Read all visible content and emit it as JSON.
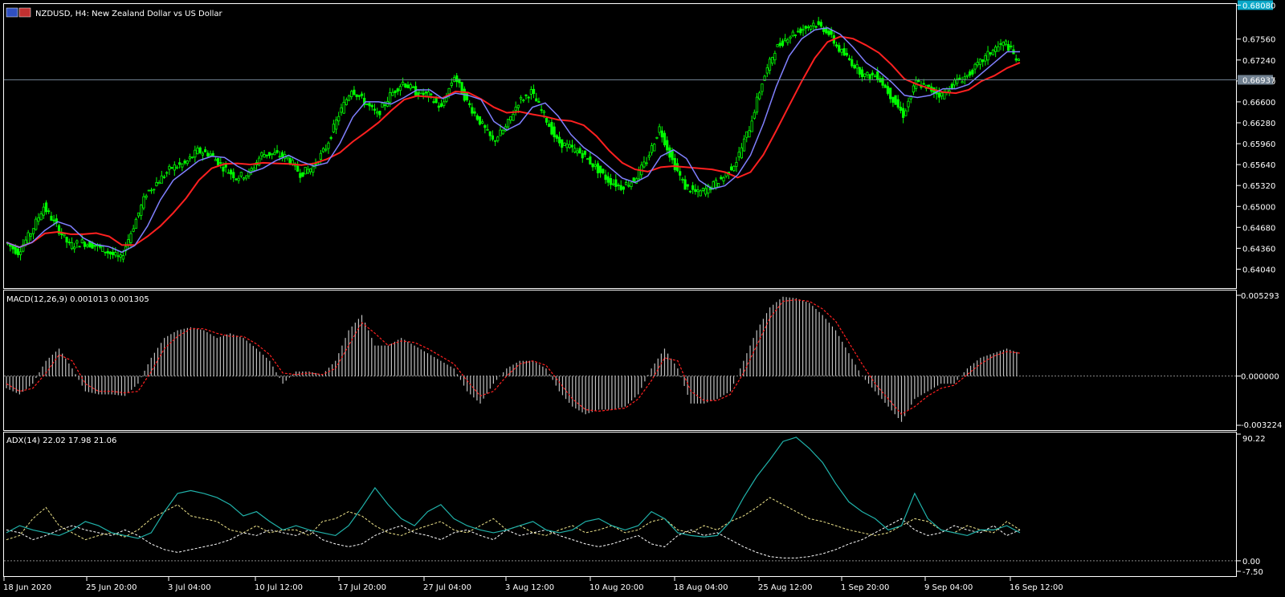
{
  "window": {
    "symbol_title": "NZDUSD, H4:  New Zealand Dollar vs US Dollar",
    "icon": "flag-icon"
  },
  "colors": {
    "background": "#000000",
    "grid": "#ffffff",
    "bull_candle": "#00ff00",
    "fast_ma": "#8080ff",
    "slow_ma": "#ff2020",
    "macd_hist": "#c0c0c0",
    "macd_signal": "#ff2020",
    "adx_main": "#20b2aa",
    "adx_plus": "#f0e68c",
    "adx_minus": "#ffffff",
    "bid_line": "#708090"
  },
  "chart_data": [
    {
      "type": "line",
      "title": "NZDUSD, H4:  New Zealand Dollar vs US Dollar",
      "ylim": [
        0.638,
        0.6806
      ],
      "price_ticks": [
        "0.68080",
        "0.67560",
        "0.67240",
        "0.66920",
        "0.66600",
        "0.66280",
        "0.65960",
        "0.65640",
        "0.65320",
        "0.65000",
        "0.64680",
        "0.64360",
        "0.64040"
      ],
      "current_price": "0.66937",
      "top_price": "0.68080",
      "x_ticks": [
        "18 Jun 2020",
        "25 Jun 20:00",
        "3 Jul 04:00",
        "10 Jul 12:00",
        "17 Jul 20:00",
        "27 Jul 04:00",
        "3 Aug 12:00",
        "10 Aug 20:00",
        "18 Aug 04:00",
        "25 Aug 12:00",
        "1 Sep 20:00",
        "9 Sep 04:00",
        "16 Sep 12:00"
      ],
      "series": [
        {
          "values_close": [
            0.6445,
            0.643,
            0.646,
            0.65,
            0.647,
            0.644,
            0.6445,
            0.644,
            0.643,
            0.642,
            0.647,
            0.652,
            0.654,
            0.656,
            0.6565,
            0.6585,
            0.658,
            0.656,
            0.6545,
            0.655,
            0.658,
            0.658,
            0.6575,
            0.655,
            0.656,
            0.659,
            0.664,
            0.668,
            0.666,
            0.664,
            0.667,
            0.669,
            0.6675,
            0.667,
            0.665,
            0.67,
            0.666,
            0.663,
            0.66,
            0.662,
            0.666,
            0.6675,
            0.664,
            0.66,
            0.659,
            0.658,
            0.656,
            0.654,
            0.653,
            0.654,
            0.657,
            0.662,
            0.657,
            0.653,
            0.652,
            0.653,
            0.6545,
            0.657,
            0.662,
            0.669,
            0.674,
            0.676,
            0.677,
            0.678,
            0.677,
            0.674,
            0.672,
            0.67,
            0.67,
            0.667,
            0.664,
            0.669,
            0.668,
            0.667,
            0.669,
            0.67,
            0.672,
            0.674,
            0.675,
            0.672
          ]
        }
      ]
    },
    {
      "type": "bar",
      "title": "MACD(12,26,9) 0.001013 0.001305",
      "ylim": [
        -0.003224,
        0.005293
      ],
      "ticks": [
        "0.005293",
        "0.000000",
        "-0.003224"
      ],
      "series": [
        {
          "name": "MACD",
          "values": [
            -0.0008,
            -0.0012,
            -0.0005,
            0.001,
            0.0018,
            0.0005,
            -0.001,
            -0.0012,
            -0.0012,
            -0.0013,
            -0.0005,
            0.0012,
            0.0025,
            0.003,
            0.0032,
            0.003,
            0.0025,
            0.0028,
            0.0025,
            0.0018,
            0.001,
            -0.0005,
            0.0003,
            0.0003,
            0.0001,
            0.001,
            0.003,
            0.004,
            0.002,
            0.002,
            0.0025,
            0.002,
            0.0015,
            0.001,
            0.0005,
            -0.001,
            -0.0018,
            -0.0005,
            0.0005,
            0.001,
            0.001,
            0.0005,
            -0.001,
            -0.002,
            -0.0025,
            -0.0022,
            -0.0022,
            -0.002,
            -0.0012,
            0.0005,
            0.0018,
            0.0005,
            -0.0018,
            -0.0018,
            -0.0015,
            -0.001,
            0.001,
            0.003,
            0.0045,
            0.0052,
            0.0051,
            0.0048,
            0.004,
            0.003,
            0.0015,
            0.0,
            -0.001,
            -0.002,
            -0.003,
            -0.0015,
            -0.001,
            -0.0005,
            -0.0005,
            0.0005,
            0.0012,
            0.0015,
            0.0018,
            0.0015
          ]
        },
        {
          "name": "Signal",
          "values": [
            -0.0005,
            -0.001,
            -0.0008,
            0.0002,
            0.0014,
            0.001,
            -0.0005,
            -0.001,
            -0.001,
            -0.0011,
            -0.001,
            0.0003,
            0.0018,
            0.0026,
            0.0031,
            0.0031,
            0.0028,
            0.0026,
            0.0026,
            0.0021,
            0.0014,
            0.0002,
            0.0001,
            0.0002,
            0.0001,
            0.0005,
            0.002,
            0.0035,
            0.0028,
            0.002,
            0.0023,
            0.0022,
            0.0018,
            0.0013,
            0.0008,
            -0.0003,
            -0.0013,
            -0.001,
            0.0,
            0.0008,
            0.001,
            0.0007,
            -0.0004,
            -0.0015,
            -0.0022,
            -0.0023,
            -0.0022,
            -0.0021,
            -0.0015,
            -0.0003,
            0.0012,
            0.001,
            -0.001,
            -0.0016,
            -0.0016,
            -0.0012,
            0.0002,
            0.002,
            0.0038,
            0.0049,
            0.005,
            0.0049,
            0.0044,
            0.0036,
            0.0022,
            0.0008,
            -0.0005,
            -0.0015,
            -0.0025,
            -0.002,
            -0.0013,
            -0.0008,
            -0.0006,
            0.0001,
            0.0008,
            0.0013,
            0.0016,
            0.0015
          ]
        }
      ]
    },
    {
      "type": "line",
      "title": "ADX(14) 22.02 17.98 21.06",
      "ylim": [
        -7.5,
        90.22
      ],
      "ticks": [
        "90.22",
        "0.00",
        "-7.50"
      ],
      "series": [
        {
          "name": "ADX",
          "values": [
            20,
            25,
            22,
            20,
            18,
            22,
            28,
            25,
            20,
            18,
            16,
            20,
            35,
            48,
            50,
            48,
            45,
            40,
            32,
            35,
            28,
            22,
            25,
            22,
            20,
            18,
            25,
            38,
            52,
            40,
            30,
            25,
            35,
            40,
            30,
            25,
            22,
            20,
            22,
            25,
            28,
            22,
            20,
            22,
            28,
            30,
            25,
            22,
            25,
            35,
            30,
            20,
            18,
            17,
            18,
            28,
            45,
            60,
            72,
            85,
            88,
            80,
            70,
            55,
            42,
            35,
            30,
            22,
            25,
            48,
            30,
            22,
            20,
            18,
            22,
            22,
            25,
            20
          ]
        },
        {
          "name": "+DI",
          "values": [
            15,
            18,
            30,
            38,
            25,
            20,
            15,
            18,
            20,
            17,
            22,
            30,
            35,
            40,
            32,
            30,
            28,
            22,
            20,
            25,
            20,
            22,
            22,
            18,
            28,
            30,
            35,
            32,
            25,
            20,
            18,
            22,
            25,
            28,
            22,
            20,
            25,
            30,
            22,
            25,
            20,
            18,
            22,
            25,
            20,
            22,
            25,
            20,
            22,
            28,
            30,
            22,
            20,
            25,
            22,
            28,
            32,
            38,
            45,
            40,
            35,
            30,
            28,
            25,
            22,
            20,
            18,
            20,
            25,
            30,
            28,
            22,
            20,
            25,
            22,
            20,
            28,
            22
          ]
        },
        {
          "name": "-DI",
          "values": [
            22,
            20,
            15,
            18,
            22,
            25,
            22,
            20,
            18,
            22,
            18,
            12,
            8,
            6,
            8,
            10,
            12,
            15,
            20,
            18,
            22,
            20,
            18,
            22,
            15,
            12,
            10,
            12,
            18,
            22,
            25,
            20,
            18,
            15,
            20,
            22,
            18,
            15,
            22,
            18,
            20,
            22,
            18,
            15,
            12,
            10,
            12,
            15,
            18,
            12,
            10,
            18,
            22,
            18,
            20,
            15,
            10,
            6,
            3,
            2,
            2,
            3,
            5,
            8,
            12,
            15,
            20,
            25,
            30,
            22,
            18,
            20,
            25,
            22,
            20,
            25,
            18,
            22
          ]
        }
      ]
    }
  ]
}
